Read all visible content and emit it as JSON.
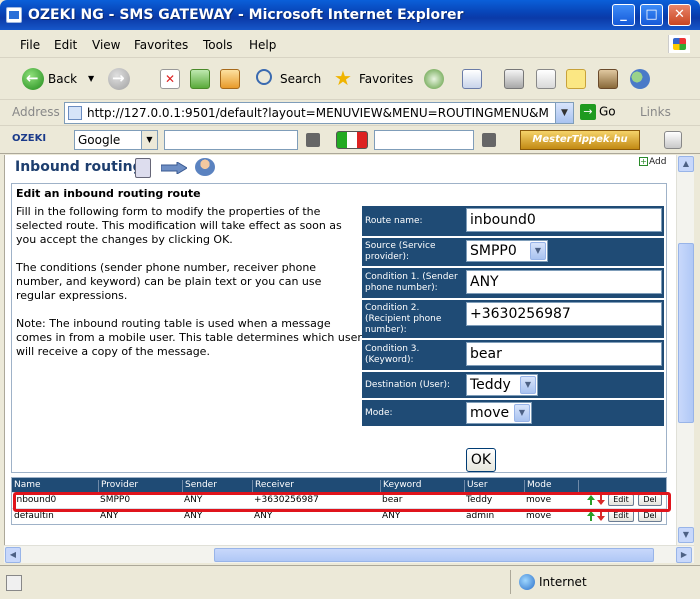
{
  "window": {
    "title": "OZEKI NG - SMS GATEWAY - Microsoft Internet Explorer",
    "min": "_",
    "max": "□",
    "close": "✕"
  },
  "menu": [
    "File",
    "Edit",
    "View",
    "Favorites",
    "Tools",
    "Help"
  ],
  "toolbar": {
    "back": "Back",
    "search": "Search",
    "favorites": "Favorites"
  },
  "address": {
    "label": "Address",
    "url": "http://127.0.0.1:9501/default?layout=MENUVIEW&MENU=ROUTINGMENU&M",
    "go": "Go",
    "links": "Links"
  },
  "googlebar": {
    "logo": "OZEKI",
    "engine": "Google",
    "brand": "MesterTippek.hu"
  },
  "page": {
    "title": "Inbound routing",
    "add": "Add",
    "form_heading": "Edit an inbound routing route",
    "description": "Fill in the following form to modify the properties of the selected route. This modification will take effect as soon as you accept the changes by clicking OK.\n\nThe conditions (sender phone number, receiver phone number, and keyword) can be plain text or you can use regular expressions.\n\nNote: The inbound routing table is used when a message comes in from a mobile user. This table determines which user will receive a copy of the message.",
    "fields": {
      "route_name": {
        "label": "Route name:",
        "value": "inbound0"
      },
      "source": {
        "label": "Source (Service provider):",
        "value": "SMPP0"
      },
      "cond1": {
        "label": "Condition 1. (Sender phone number):",
        "value": "ANY"
      },
      "cond2": {
        "label": "Condition 2. (Recipient phone number):",
        "value": "+3630256987"
      },
      "cond3": {
        "label": "Condition 3. (Keyword):",
        "value": "bear"
      },
      "destination": {
        "label": "Destination (User):",
        "value": "Teddy"
      },
      "mode": {
        "label": "Mode:",
        "value": "move"
      }
    },
    "ok": "OK"
  },
  "table": {
    "headers": [
      "Name",
      "Provider",
      "Sender",
      "Receiver",
      "Keyword",
      "User",
      "Mode"
    ],
    "rows": [
      [
        "inbound0",
        "SMPP0",
        "ANY",
        "+3630256987",
        "bear",
        "Teddy",
        "move"
      ],
      [
        "defaultin",
        "ANY",
        "ANY",
        "ANY",
        "ANY",
        "admin",
        "move"
      ]
    ],
    "edit": "Edit",
    "del": "Del"
  },
  "status": {
    "zone": "Internet"
  }
}
